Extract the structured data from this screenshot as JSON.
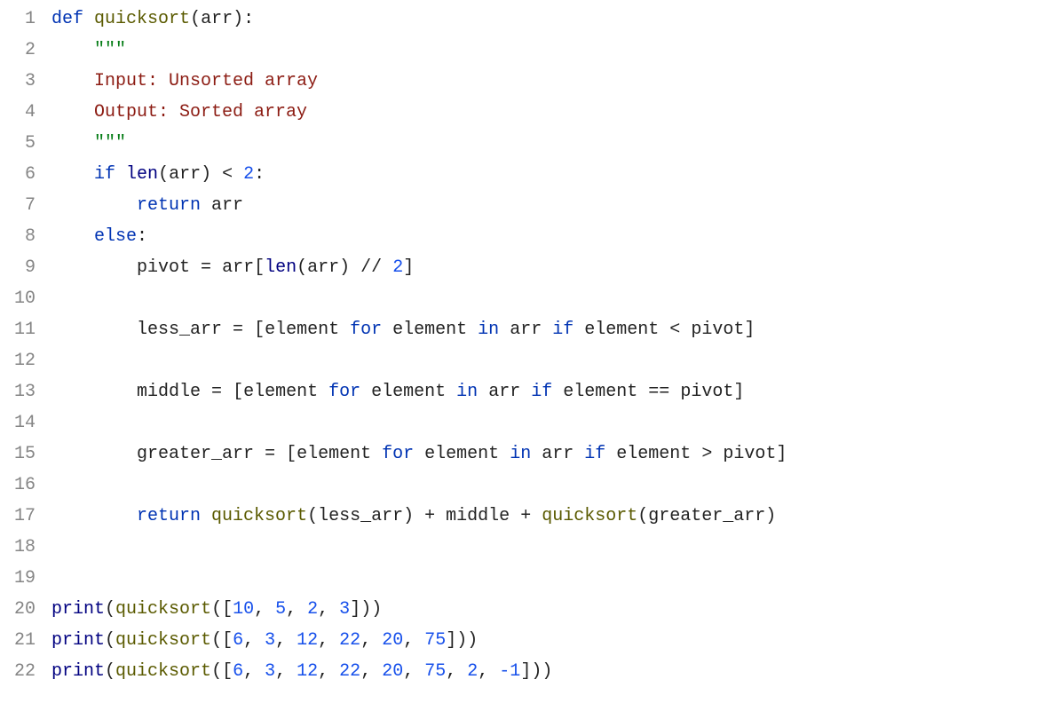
{
  "lineCount": 22,
  "lines": [
    {
      "n": 1,
      "tokens": [
        {
          "c": "kw",
          "t": "def"
        },
        {
          "c": "pun",
          "t": " "
        },
        {
          "c": "fn",
          "t": "quicksort"
        },
        {
          "c": "pun",
          "t": "("
        },
        {
          "c": "id",
          "t": "arr"
        },
        {
          "c": "pun",
          "t": "):"
        }
      ]
    },
    {
      "n": 2,
      "indent": 4,
      "tokens": [
        {
          "c": "strq",
          "t": "\"\"\""
        }
      ]
    },
    {
      "n": 3,
      "indent": 4,
      "tokens": [
        {
          "c": "str",
          "t": "Input: Unsorted array"
        }
      ]
    },
    {
      "n": 4,
      "indent": 4,
      "tokens": [
        {
          "c": "str",
          "t": "Output: Sorted array"
        }
      ]
    },
    {
      "n": 5,
      "indent": 4,
      "tokens": [
        {
          "c": "strq",
          "t": "\"\"\""
        }
      ]
    },
    {
      "n": 6,
      "indent": 4,
      "tokens": [
        {
          "c": "kw",
          "t": "if"
        },
        {
          "c": "pun",
          "t": " "
        },
        {
          "c": "bi",
          "t": "len"
        },
        {
          "c": "pun",
          "t": "("
        },
        {
          "c": "id",
          "t": "arr"
        },
        {
          "c": "pun",
          "t": ") "
        },
        {
          "c": "op",
          "t": "<"
        },
        {
          "c": "pun",
          "t": " "
        },
        {
          "c": "num",
          "t": "2"
        },
        {
          "c": "pun",
          "t": ":"
        }
      ]
    },
    {
      "n": 7,
      "indent": 8,
      "tokens": [
        {
          "c": "kw",
          "t": "return"
        },
        {
          "c": "pun",
          "t": " "
        },
        {
          "c": "id",
          "t": "arr"
        }
      ]
    },
    {
      "n": 8,
      "indent": 4,
      "tokens": [
        {
          "c": "kw",
          "t": "else"
        },
        {
          "c": "pun",
          "t": ":"
        }
      ]
    },
    {
      "n": 9,
      "indent": 8,
      "tokens": [
        {
          "c": "id",
          "t": "pivot"
        },
        {
          "c": "pun",
          "t": " "
        },
        {
          "c": "op",
          "t": "="
        },
        {
          "c": "pun",
          "t": " "
        },
        {
          "c": "id",
          "t": "arr"
        },
        {
          "c": "pun",
          "t": "["
        },
        {
          "c": "bi",
          "t": "len"
        },
        {
          "c": "pun",
          "t": "("
        },
        {
          "c": "id",
          "t": "arr"
        },
        {
          "c": "pun",
          "t": ") "
        },
        {
          "c": "op",
          "t": "//"
        },
        {
          "c": "pun",
          "t": " "
        },
        {
          "c": "num",
          "t": "2"
        },
        {
          "c": "pun",
          "t": "]"
        }
      ]
    },
    {
      "n": 10,
      "indent": 0,
      "tokens": []
    },
    {
      "n": 11,
      "indent": 8,
      "tokens": [
        {
          "c": "id",
          "t": "less_arr"
        },
        {
          "c": "pun",
          "t": " "
        },
        {
          "c": "op",
          "t": "="
        },
        {
          "c": "pun",
          "t": " ["
        },
        {
          "c": "id",
          "t": "element"
        },
        {
          "c": "pun",
          "t": " "
        },
        {
          "c": "kw",
          "t": "for"
        },
        {
          "c": "pun",
          "t": " "
        },
        {
          "c": "id",
          "t": "element"
        },
        {
          "c": "pun",
          "t": " "
        },
        {
          "c": "kw",
          "t": "in"
        },
        {
          "c": "pun",
          "t": " "
        },
        {
          "c": "id",
          "t": "arr"
        },
        {
          "c": "pun",
          "t": " "
        },
        {
          "c": "kw",
          "t": "if"
        },
        {
          "c": "pun",
          "t": " "
        },
        {
          "c": "id",
          "t": "element"
        },
        {
          "c": "pun",
          "t": " "
        },
        {
          "c": "op",
          "t": "<"
        },
        {
          "c": "pun",
          "t": " "
        },
        {
          "c": "id",
          "t": "pivot"
        },
        {
          "c": "pun",
          "t": "]"
        }
      ]
    },
    {
      "n": 12,
      "indent": 0,
      "tokens": []
    },
    {
      "n": 13,
      "indent": 8,
      "tokens": [
        {
          "c": "id",
          "t": "middle"
        },
        {
          "c": "pun",
          "t": " "
        },
        {
          "c": "op",
          "t": "="
        },
        {
          "c": "pun",
          "t": " ["
        },
        {
          "c": "id",
          "t": "element"
        },
        {
          "c": "pun",
          "t": " "
        },
        {
          "c": "kw",
          "t": "for"
        },
        {
          "c": "pun",
          "t": " "
        },
        {
          "c": "id",
          "t": "element"
        },
        {
          "c": "pun",
          "t": " "
        },
        {
          "c": "kw",
          "t": "in"
        },
        {
          "c": "pun",
          "t": " "
        },
        {
          "c": "id",
          "t": "arr"
        },
        {
          "c": "pun",
          "t": " "
        },
        {
          "c": "kw",
          "t": "if"
        },
        {
          "c": "pun",
          "t": " "
        },
        {
          "c": "id",
          "t": "element"
        },
        {
          "c": "pun",
          "t": " "
        },
        {
          "c": "op",
          "t": "=="
        },
        {
          "c": "pun",
          "t": " "
        },
        {
          "c": "id",
          "t": "pivot"
        },
        {
          "c": "pun",
          "t": "]"
        }
      ]
    },
    {
      "n": 14,
      "indent": 0,
      "tokens": []
    },
    {
      "n": 15,
      "indent": 8,
      "tokens": [
        {
          "c": "id",
          "t": "greater_arr"
        },
        {
          "c": "pun",
          "t": " "
        },
        {
          "c": "op",
          "t": "="
        },
        {
          "c": "pun",
          "t": " ["
        },
        {
          "c": "id",
          "t": "element"
        },
        {
          "c": "pun",
          "t": " "
        },
        {
          "c": "kw",
          "t": "for"
        },
        {
          "c": "pun",
          "t": " "
        },
        {
          "c": "id",
          "t": "element"
        },
        {
          "c": "pun",
          "t": " "
        },
        {
          "c": "kw",
          "t": "in"
        },
        {
          "c": "pun",
          "t": " "
        },
        {
          "c": "id",
          "t": "arr"
        },
        {
          "c": "pun",
          "t": " "
        },
        {
          "c": "kw",
          "t": "if"
        },
        {
          "c": "pun",
          "t": " "
        },
        {
          "c": "id",
          "t": "element"
        },
        {
          "c": "pun",
          "t": " "
        },
        {
          "c": "op",
          "t": ">"
        },
        {
          "c": "pun",
          "t": " "
        },
        {
          "c": "id",
          "t": "pivot"
        },
        {
          "c": "pun",
          "t": "]"
        }
      ]
    },
    {
      "n": 16,
      "indent": 0,
      "tokens": []
    },
    {
      "n": 17,
      "indent": 8,
      "tokens": [
        {
          "c": "kw",
          "t": "return"
        },
        {
          "c": "pun",
          "t": " "
        },
        {
          "c": "fn",
          "t": "quicksort"
        },
        {
          "c": "pun",
          "t": "("
        },
        {
          "c": "id",
          "t": "less_arr"
        },
        {
          "c": "pun",
          "t": ") "
        },
        {
          "c": "op",
          "t": "+"
        },
        {
          "c": "pun",
          "t": " "
        },
        {
          "c": "id",
          "t": "middle"
        },
        {
          "c": "pun",
          "t": " "
        },
        {
          "c": "op",
          "t": "+"
        },
        {
          "c": "pun",
          "t": " "
        },
        {
          "c": "fn",
          "t": "quicksort"
        },
        {
          "c": "pun",
          "t": "("
        },
        {
          "c": "id",
          "t": "greater_arr"
        },
        {
          "c": "pun",
          "t": ")"
        }
      ]
    },
    {
      "n": 18,
      "indent": 0,
      "tokens": []
    },
    {
      "n": 19,
      "indent": 0,
      "tokens": []
    },
    {
      "n": 20,
      "indent": 0,
      "tokens": [
        {
          "c": "bi",
          "t": "print"
        },
        {
          "c": "pun",
          "t": "("
        },
        {
          "c": "fn",
          "t": "quicksort"
        },
        {
          "c": "pun",
          "t": "(["
        },
        {
          "c": "num",
          "t": "10"
        },
        {
          "c": "pun",
          "t": ", "
        },
        {
          "c": "num",
          "t": "5"
        },
        {
          "c": "pun",
          "t": ", "
        },
        {
          "c": "num",
          "t": "2"
        },
        {
          "c": "pun",
          "t": ", "
        },
        {
          "c": "num",
          "t": "3"
        },
        {
          "c": "pun",
          "t": "]))"
        }
      ]
    },
    {
      "n": 21,
      "indent": 0,
      "tokens": [
        {
          "c": "bi",
          "t": "print"
        },
        {
          "c": "pun",
          "t": "("
        },
        {
          "c": "fn",
          "t": "quicksort"
        },
        {
          "c": "pun",
          "t": "(["
        },
        {
          "c": "num",
          "t": "6"
        },
        {
          "c": "pun",
          "t": ", "
        },
        {
          "c": "num",
          "t": "3"
        },
        {
          "c": "pun",
          "t": ", "
        },
        {
          "c": "num",
          "t": "12"
        },
        {
          "c": "pun",
          "t": ", "
        },
        {
          "c": "num",
          "t": "22"
        },
        {
          "c": "pun",
          "t": ", "
        },
        {
          "c": "num",
          "t": "20"
        },
        {
          "c": "pun",
          "t": ", "
        },
        {
          "c": "num",
          "t": "75"
        },
        {
          "c": "pun",
          "t": "]))"
        }
      ]
    },
    {
      "n": 22,
      "indent": 0,
      "tokens": [
        {
          "c": "bi",
          "t": "print"
        },
        {
          "c": "pun",
          "t": "("
        },
        {
          "c": "fn",
          "t": "quicksort"
        },
        {
          "c": "pun",
          "t": "(["
        },
        {
          "c": "num",
          "t": "6"
        },
        {
          "c": "pun",
          "t": ", "
        },
        {
          "c": "num",
          "t": "3"
        },
        {
          "c": "pun",
          "t": ", "
        },
        {
          "c": "num",
          "t": "12"
        },
        {
          "c": "pun",
          "t": ", "
        },
        {
          "c": "num",
          "t": "22"
        },
        {
          "c": "pun",
          "t": ", "
        },
        {
          "c": "num",
          "t": "20"
        },
        {
          "c": "pun",
          "t": ", "
        },
        {
          "c": "num",
          "t": "75"
        },
        {
          "c": "pun",
          "t": ", "
        },
        {
          "c": "num",
          "t": "2"
        },
        {
          "c": "pun",
          "t": ", "
        },
        {
          "c": "num",
          "t": "-1"
        },
        {
          "c": "pun",
          "t": "]))"
        }
      ]
    }
  ]
}
